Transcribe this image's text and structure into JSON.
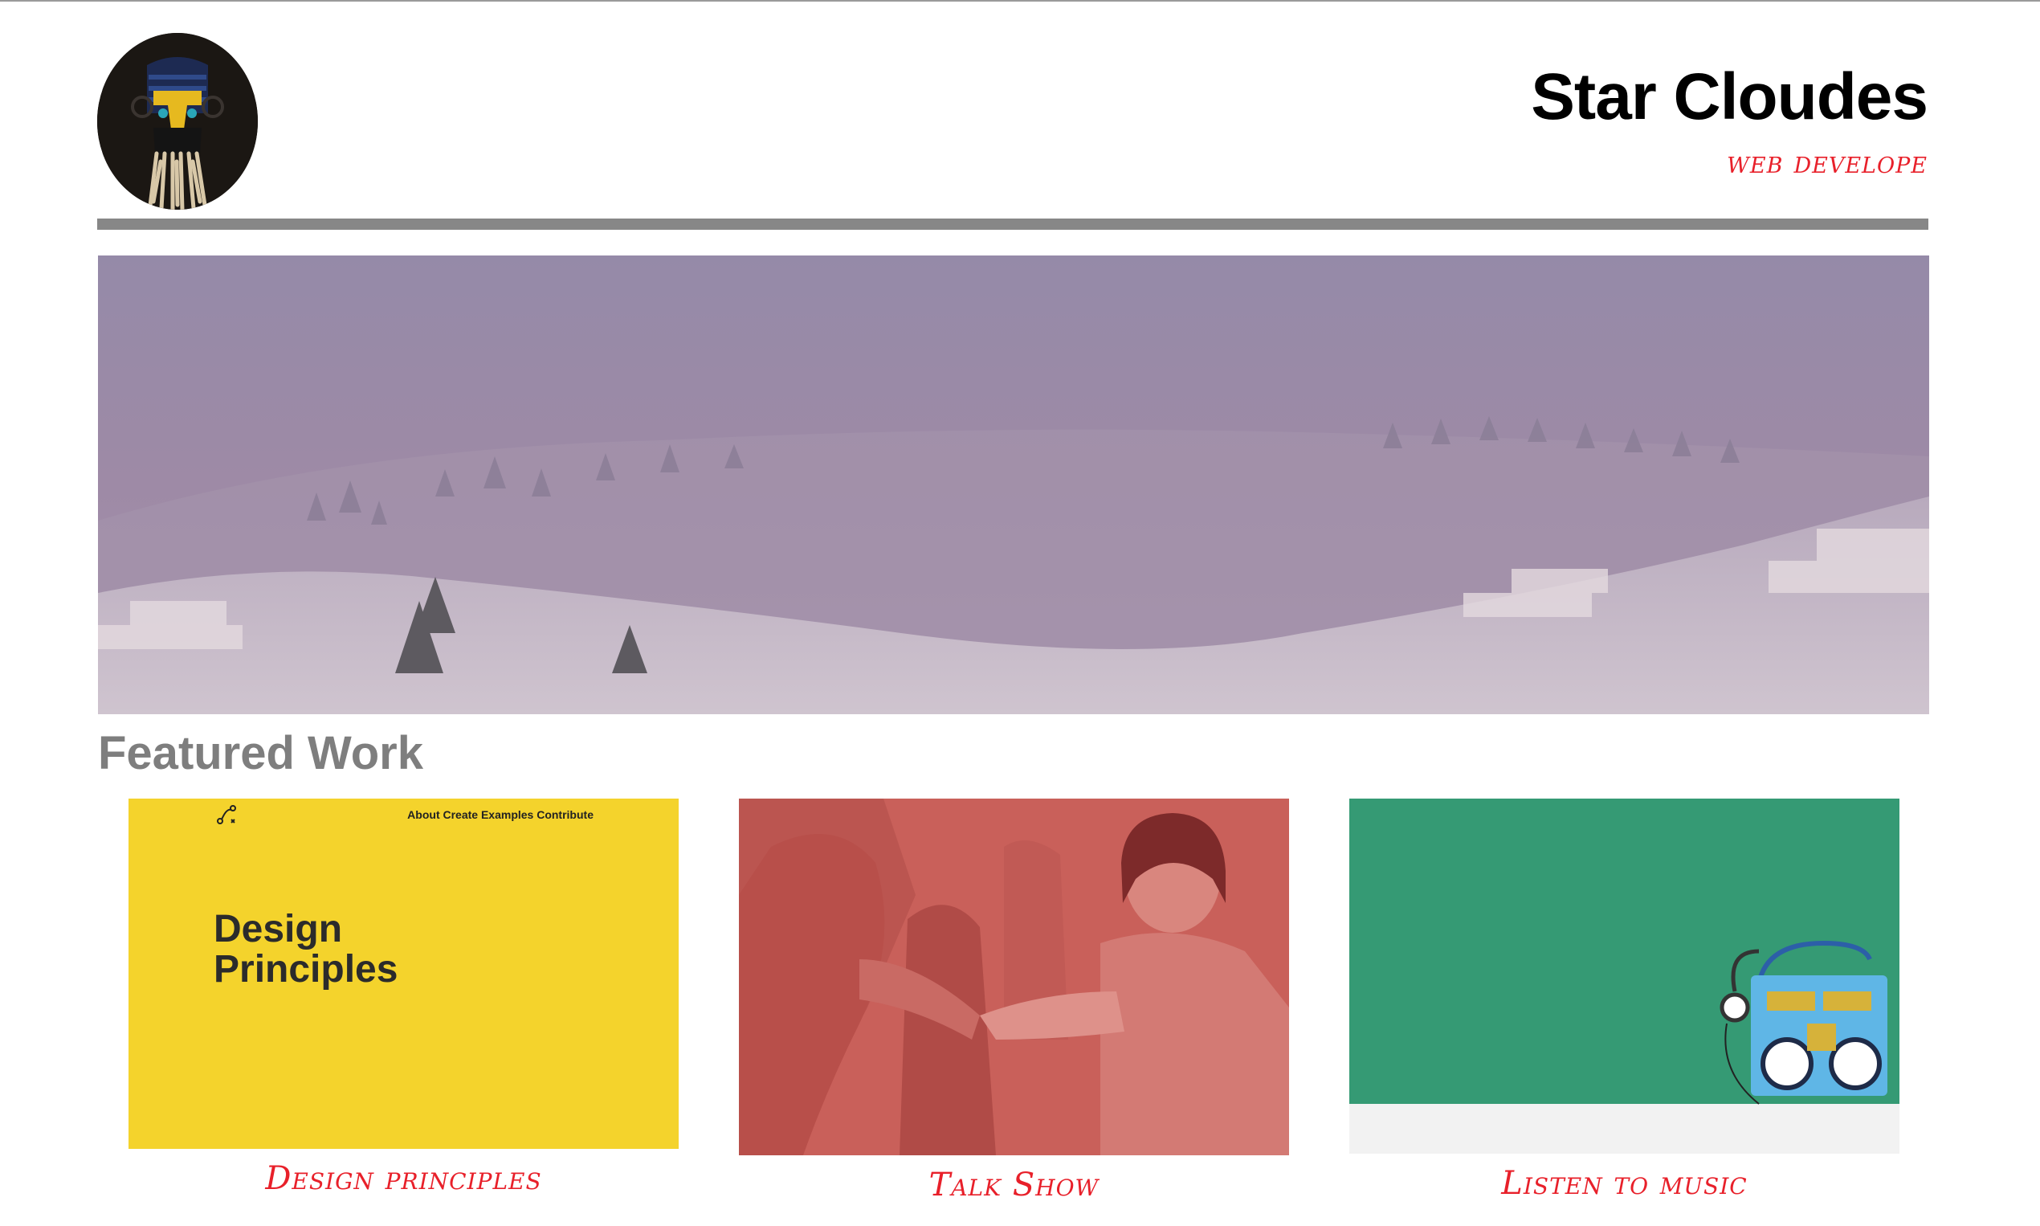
{
  "header": {
    "title": "Star Cloudes",
    "subtitle": "web develope"
  },
  "featured": {
    "heading": "Featured Work",
    "cards": [
      {
        "caption": "Design principles",
        "thumb_nav": "About Create Examples Contribute",
        "thumb_title_line1": "Design",
        "thumb_title_line2": "Principles"
      },
      {
        "caption": "Talk Show"
      },
      {
        "caption": "Listen to music"
      }
    ]
  },
  "colors": {
    "accent": "#e8202a",
    "divider": "#878787",
    "heading": "#7e7e7e",
    "card_yellow": "#f4d32c",
    "card_red": "#c9605a",
    "card_green": "#359a74"
  },
  "icons": {
    "avatar": "masked-figure-avatar",
    "thumb_logo": "vector-path-icon"
  }
}
